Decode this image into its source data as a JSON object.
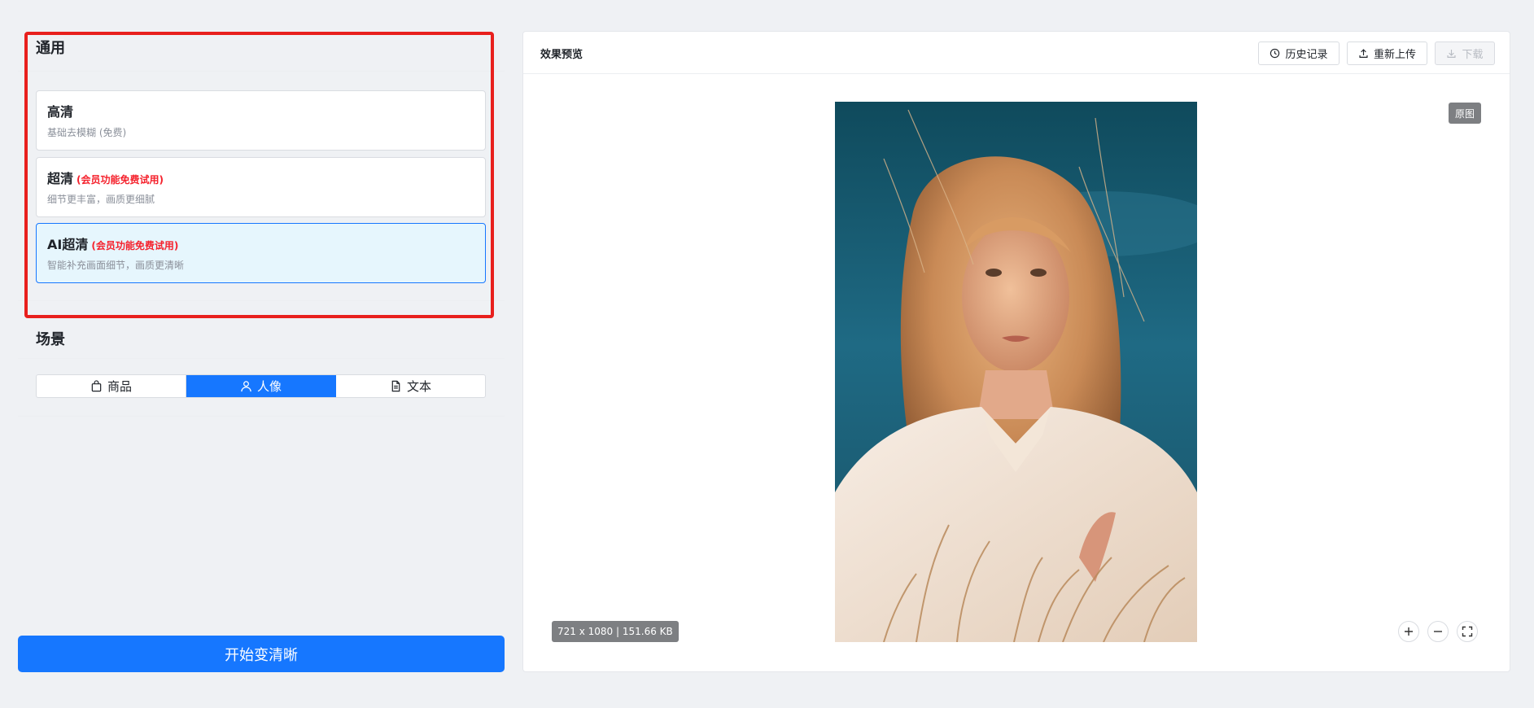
{
  "left": {
    "general_title": "通用",
    "options": [
      {
        "name": "高清",
        "tag": "",
        "desc": "基础去模糊 (免费)"
      },
      {
        "name": "超清",
        "tag": "(会员功能免费试用)",
        "desc": "细节更丰富，画质更细腻"
      },
      {
        "name": "AI超清",
        "tag": "(会员功能免费试用)",
        "desc": "智能补充画面细节，画质更清晰"
      }
    ],
    "scene_title": "场景",
    "scenes": [
      "商品",
      "人像",
      "文本"
    ],
    "selected_scene": "人像",
    "start_button": "开始变清晰"
  },
  "preview": {
    "title": "效果预览",
    "history_button": "历史记录",
    "reupload_button": "重新上传",
    "download_button": "下载",
    "original_badge": "原图",
    "image_info": "721 x 1080 | 151.66 KB"
  },
  "colors": {
    "accent": "#1677ff",
    "highlight_outline": "#e8201d",
    "member_tag": "#f5222d",
    "selected_bg": "#e6f6fd"
  },
  "icons": {
    "scene_icons": [
      "shopping-bag-icon",
      "user-icon",
      "document-icon"
    ],
    "header_icons": [
      "clock-icon",
      "upload-icon",
      "download-icon"
    ],
    "zoom_icons": [
      "zoom-in-icon",
      "zoom-out-icon",
      "fullscreen-icon"
    ]
  }
}
